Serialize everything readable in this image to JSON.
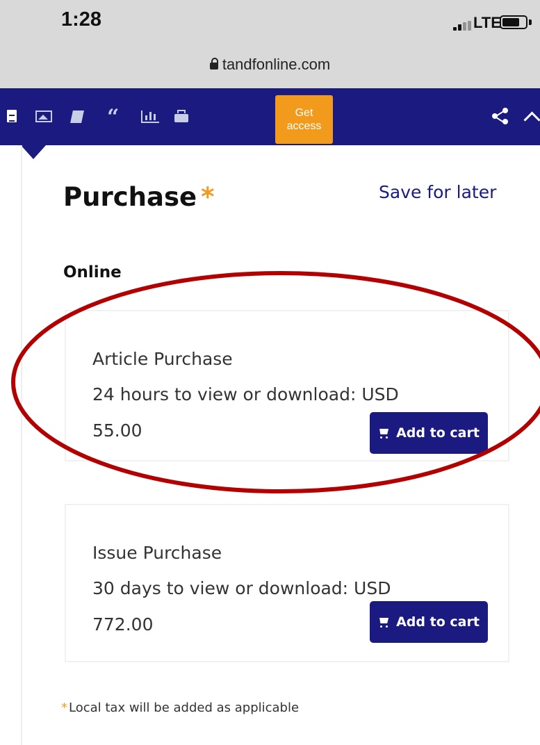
{
  "status_bar": {
    "time": "1:28",
    "network": "LTE"
  },
  "browser": {
    "url": "tandfonline.com"
  },
  "toolbar": {
    "icons": [
      "document-icon",
      "image-icon",
      "book-icon",
      "quote-icon",
      "chart-icon",
      "print-icon",
      "share-icon",
      "chevron-up-icon"
    ],
    "get_access_label": "Get access"
  },
  "purchase": {
    "title": "Purchase",
    "asterisk": "*",
    "save_for_later": "Save for later",
    "section_label": "Online",
    "options": [
      {
        "name": "Article Purchase",
        "description": "24 hours to view or download: USD",
        "price": "55.00",
        "button": "Add to cart"
      },
      {
        "name": "Issue Purchase",
        "description": "30 days to view or download: USD",
        "price": "772.00",
        "button": "Add to cart"
      }
    ],
    "tax_note": "Local tax will be added as applicable"
  },
  "colors": {
    "toolbar": "#1a1a80",
    "accent": "#f29a1b",
    "button": "#1a1a80",
    "annotation": "#b30000"
  }
}
